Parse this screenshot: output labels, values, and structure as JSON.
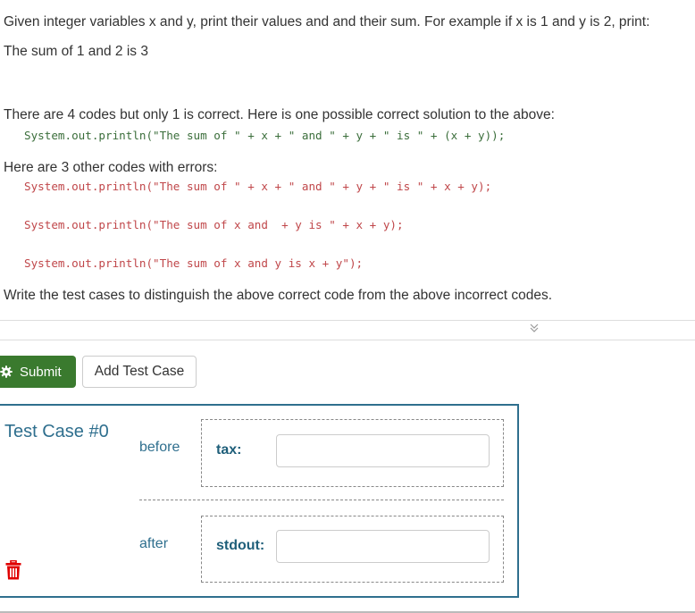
{
  "problem": {
    "intro": "Given integer variables x and y, print their values and and their sum. For example if x is 1 and y is 2, print:",
    "example_output": "The sum of 1 and 2 is 3",
    "codes_intro": "There are 4 codes but only 1 is correct. Here is one possible correct solution to the above:",
    "correct_code": "System.out.println(\"The sum of \" + x + \" and \" + y + \" is \" + (x + y));",
    "errors_intro": "Here are 3 other codes with errors:",
    "wrong_codes": [
      "System.out.println(\"The sum of \" + x + \" and \" + y + \" is \" + x + y);",
      "System.out.println(\"The sum of x and  + y is \" + x + y);",
      "System.out.println(\"The sum of x and y is x + y\");"
    ],
    "instruction": "Write the test cases to distinguish the above correct code from the above incorrect codes."
  },
  "collapse": {
    "icon": "chevron-double-down-icon",
    "glyph": "»"
  },
  "toolbar": {
    "submit_label": "Submit",
    "submit_icon": "gear-icon",
    "add_test_case_label": "Add Test Case"
  },
  "test_cases": [
    {
      "title": "Test Case #0",
      "before_label": "before",
      "after_label": "after",
      "before_field": {
        "label": "tax:",
        "value": ""
      },
      "after_field": {
        "label": "stdout:",
        "value": ""
      },
      "delete_icon": "trash-icon"
    }
  ],
  "colors": {
    "submit_green": "#3a7a2e",
    "accent_blue": "#2f6f8e",
    "correct_code": "#3b6e3b",
    "wrong_code": "#c0474a",
    "delete_red": "#e00000"
  }
}
